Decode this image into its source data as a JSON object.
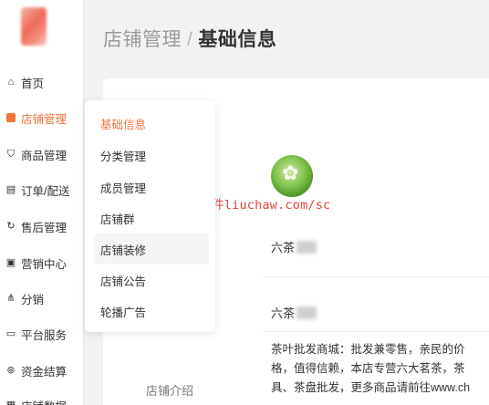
{
  "sidebar": {
    "items": [
      {
        "label": "首页",
        "icon": "home-icon",
        "glyph": "⌂"
      },
      {
        "label": "店铺管理",
        "icon": "store-icon",
        "glyph": "",
        "active": true
      },
      {
        "label": "商品管理",
        "icon": "bag-icon",
        "glyph": "⛉"
      },
      {
        "label": "订单/配送",
        "icon": "order-icon",
        "glyph": "▤"
      },
      {
        "label": "售后管理",
        "icon": "aftersale-icon",
        "glyph": "↻"
      },
      {
        "label": "营销中心",
        "icon": "marketing-icon",
        "glyph": "▣"
      },
      {
        "label": "分销",
        "icon": "distribution-icon",
        "glyph": "⋔"
      },
      {
        "label": "平台服务",
        "icon": "platform-icon",
        "glyph": "▭"
      },
      {
        "label": "资金结算",
        "icon": "funds-icon",
        "glyph": "⊛"
      },
      {
        "label": "店铺数据",
        "icon": "data-icon",
        "glyph": "▦"
      }
    ],
    "accent_color": "#f2743d"
  },
  "header": {
    "parent": "店铺管理",
    "separator": "/",
    "current": "基础信息"
  },
  "submenu": {
    "items": [
      {
        "label": "基础信息",
        "active": true
      },
      {
        "label": "分类管理"
      },
      {
        "label": "成员管理"
      },
      {
        "label": "店铺群"
      },
      {
        "label": "店铺装修",
        "hover": true
      },
      {
        "label": "店铺公告"
      },
      {
        "label": "轮播广告"
      }
    ]
  },
  "main": {
    "avatar_icon": "shop-logo-icon",
    "watermark": "餐饮软件liuchaw.com/sc",
    "fields": [
      {
        "value": "六茶"
      },
      {
        "value": "六茶"
      }
    ],
    "intro_label": "店铺介绍",
    "intro_text": "茶叶批发商城：批发兼零售，亲民的价格，值得信赖，本店专营六大茗茶，茶具、茶盘批发，更多商品请前往www.ch"
  }
}
